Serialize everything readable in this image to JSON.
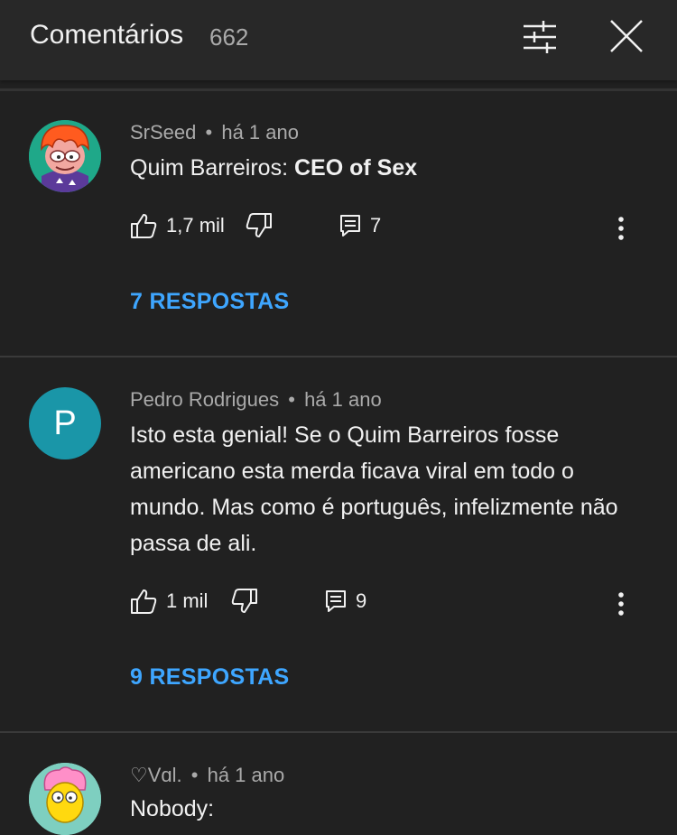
{
  "header": {
    "title": "Comentários",
    "count": "662"
  },
  "comments": [
    {
      "author": "SrSeed",
      "separator": "•",
      "time": "há 1 ano",
      "text_plain": "Quim Barreiros: ",
      "text_bold": "CEO of Sex",
      "likes": "1,7 mil",
      "reply_count": "7",
      "replies_label": "7 RESPOSTAS",
      "avatar_bg": "#1fa889"
    },
    {
      "author": "Pedro Rodrigues",
      "separator": "•",
      "time": "há 1 ano",
      "text": "Isto esta genial! Se o Quim Barreiros fosse americano esta merda ficava viral em todo o mundo. Mas como é português, infelizmente não passa de ali.",
      "avatar_letter": "P",
      "likes": "1 mil",
      "reply_count": "9",
      "replies_label": "9 RESPOSTAS",
      "avatar_bg": "#1a96a8"
    },
    {
      "author": "♡Vɑl.",
      "separator": "•",
      "time": "há 1 ano",
      "text": "Nobody:",
      "avatar_bg": "#7ecfc0"
    }
  ],
  "colors": {
    "background": "#212121",
    "header_bg": "#282828",
    "link_blue": "#3ea6ff",
    "secondary_text": "#aaaaaa"
  },
  "icons": [
    "filter-icon",
    "close-icon",
    "like-icon",
    "dislike-icon",
    "reply-icon",
    "more-vert-icon"
  ]
}
